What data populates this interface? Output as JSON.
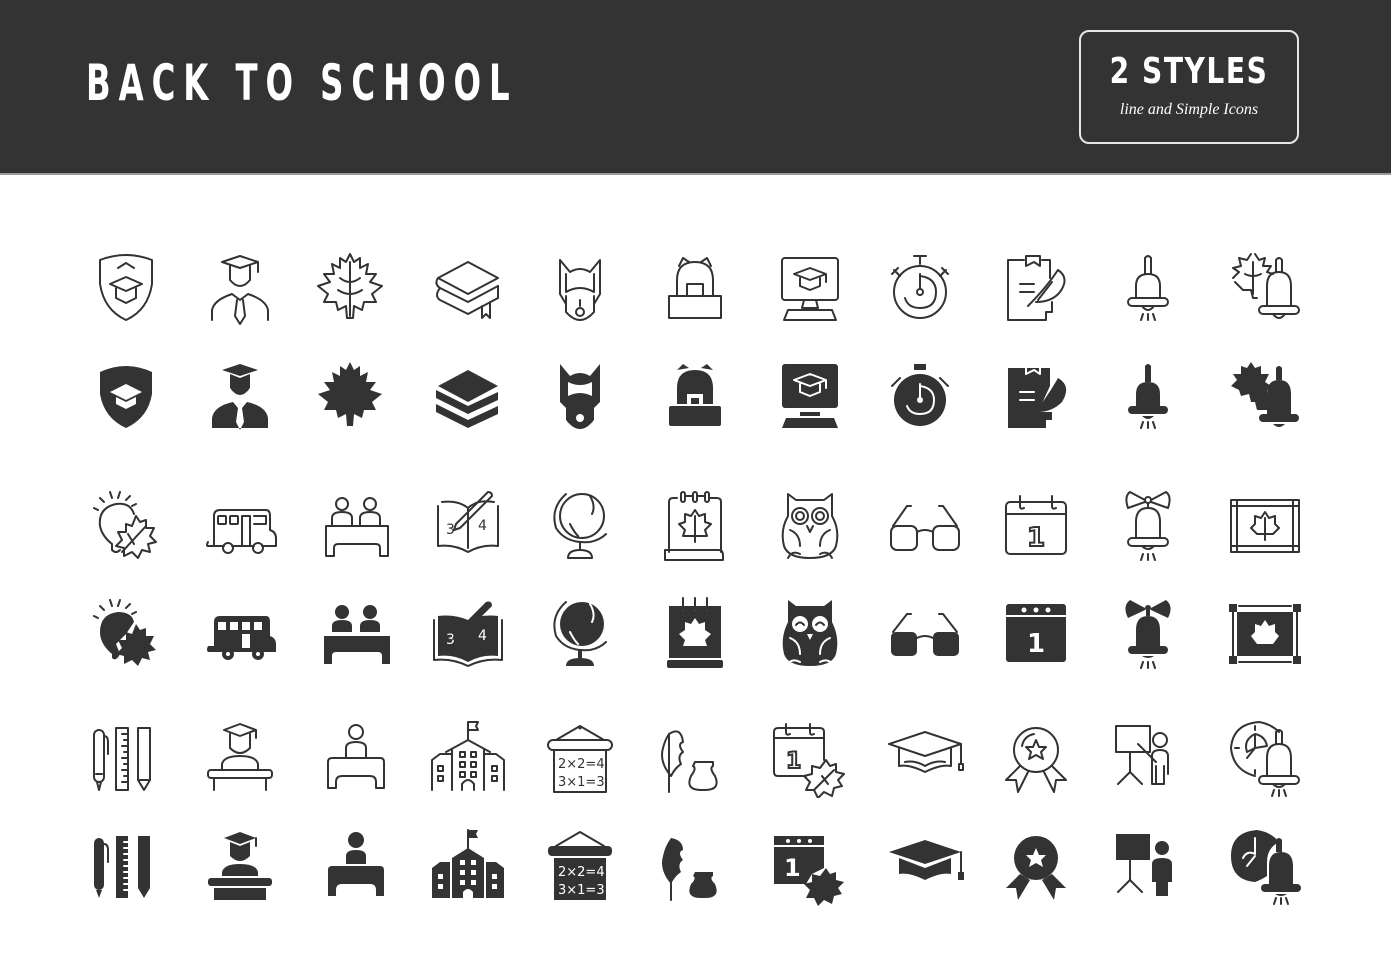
{
  "header": {
    "title": "BACK TO SCHOOL",
    "badge_main": "2 STYLES",
    "badge_sub": "line and Simple Icons",
    "background_color": "#333333",
    "text_color": "#ffffff"
  },
  "icon_color": "#333333",
  "icon_sets": [
    {
      "group": 1,
      "icons": [
        "shield-graduation-cap",
        "graduate-student",
        "maple-leaf",
        "book-stack",
        "backpack-front",
        "school-backpack",
        "online-education-monitor",
        "stopwatch",
        "clipboard-quill",
        "school-bell",
        "leaf-and-bell"
      ]
    },
    {
      "group": 2,
      "icons": [
        "idea-bulb-leaf",
        "school-bus",
        "students-at-desk",
        "open-book-math",
        "globe",
        "autumn-calendar",
        "owl",
        "glasses",
        "calendar-day-1",
        "bell-with-bow",
        "framed-leaf"
      ]
    },
    {
      "group": 3,
      "icons": [
        "pen-ruler-pencil",
        "graduate-podium",
        "student-at-desk",
        "school-building",
        "math-board",
        "quill-inkwell",
        "calendar-1-leaf",
        "graduation-cap",
        "award-medal",
        "teacher-whiteboard",
        "clock-bell"
      ]
    }
  ],
  "math_board": {
    "line1": "2×2=4",
    "line2": "3×1=3"
  },
  "book_numbers": {
    "left": "3",
    "right": "4"
  },
  "calendar_number": "1"
}
